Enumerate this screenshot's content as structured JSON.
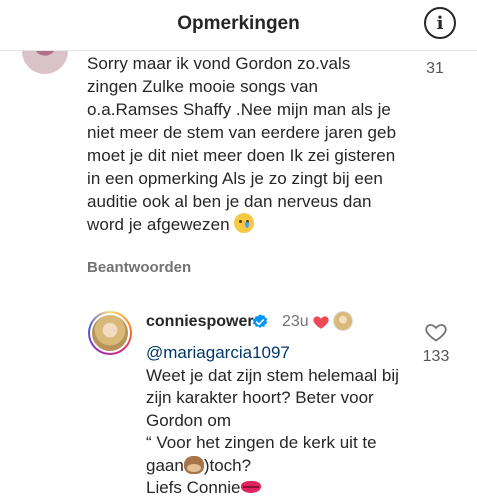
{
  "header": {
    "title": "Opmerkingen",
    "info_icon": "i"
  },
  "comment1": {
    "text": "Sorry maar ik vond Gordon zo.vals zingen Zulke mooie songs van o.a.Ramses Shaffy .Nee mijn man als je niet meer de stem van eerdere jaren geb moet je dit niet meer doen Ik zei gisteren in een opmerking Als je zo zingt bij een auditie ook al ben je dan nerveus dan word je afgewezen",
    "emoji_icon": "crying-face-icon",
    "likes": "31",
    "reply_label": "Beantwoorden"
  },
  "comment2": {
    "username": "conniespower",
    "time": "23u",
    "mention": "@mariagarcia1097",
    "text_part1": "Weet je dat zijn stem helemaal bij zijn karakter hoort? Beter voor Gordon om",
    "text_part2": "“ Voor het zingen de kerk uit te gaan",
    "emoji_icon": "see-no-evil-monkey-icon",
    "text_part3": ")toch?",
    "text_part4": "Liefs Connie",
    "end_emoji_icon": "kiss-mark-icon",
    "likes": "133"
  },
  "colors": {
    "mention": "#00376b",
    "verified": "#0095f6",
    "heart": "#ed4956",
    "text": "#262626",
    "secondary": "#737373"
  }
}
